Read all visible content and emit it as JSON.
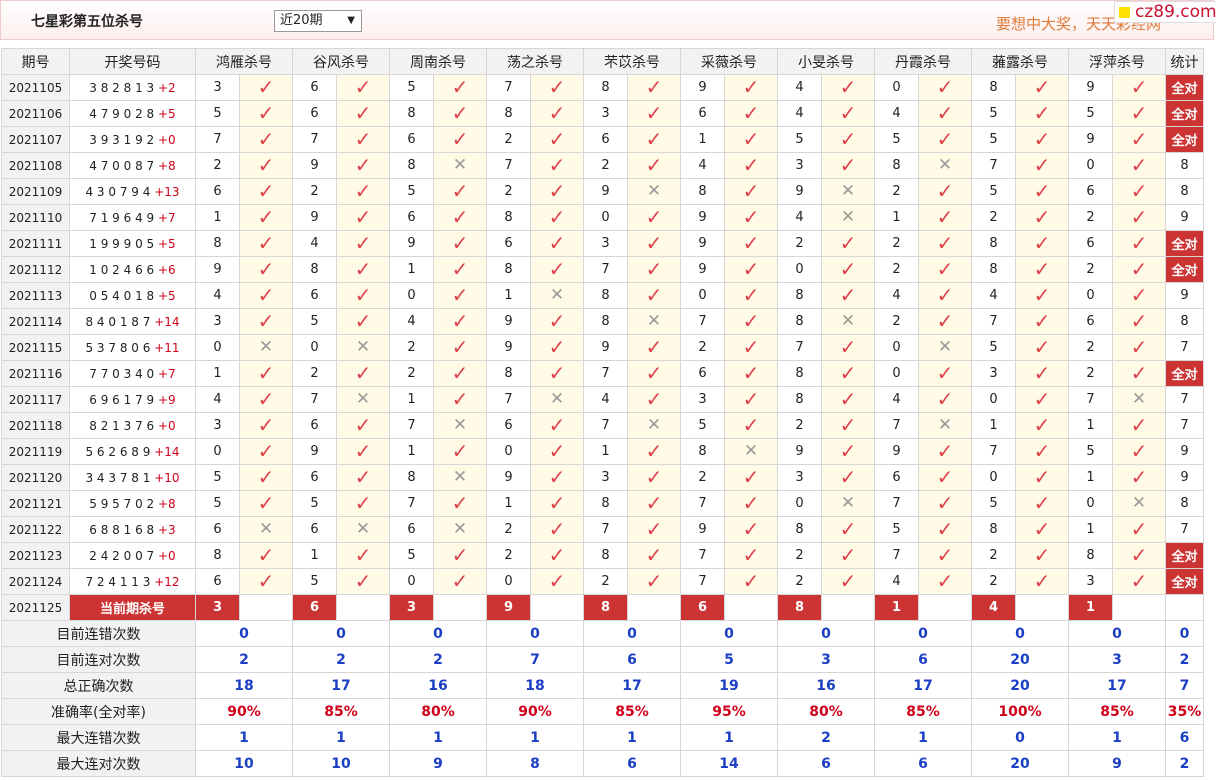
{
  "header": {
    "title": "七星彩第五位杀号",
    "period_select": "近20期",
    "slogan": "要想中大奖，天天彩经网",
    "logo": "cz89.com"
  },
  "columns": {
    "issue": "期号",
    "draw": "开奖号码",
    "experts": [
      "鸿雁杀号",
      "谷风杀号",
      "周南杀号",
      "荡之杀号",
      "芣苡杀号",
      "采薇杀号",
      "小旻杀号",
      "丹霞杀号",
      "蕥露杀号",
      "浮萍杀号"
    ],
    "stat": "统计"
  },
  "rows": [
    {
      "issue": "2021105",
      "draw": "3 8 2 8 1 3",
      "plus": "+2",
      "kills": [
        3,
        6,
        5,
        7,
        8,
        9,
        4,
        0,
        8,
        9
      ],
      "hits": [
        1,
        1,
        1,
        1,
        1,
        1,
        1,
        1,
        1,
        1
      ],
      "stat": "全对"
    },
    {
      "issue": "2021106",
      "draw": "4 7 9 0 2 8",
      "plus": "+5",
      "kills": [
        5,
        6,
        8,
        8,
        3,
        6,
        4,
        4,
        5,
        5
      ],
      "hits": [
        1,
        1,
        1,
        1,
        1,
        1,
        1,
        1,
        1,
        1
      ],
      "stat": "全对"
    },
    {
      "issue": "2021107",
      "draw": "3 9 3 1 9 2",
      "plus": "+0",
      "kills": [
        7,
        7,
        6,
        2,
        6,
        1,
        5,
        5,
        5,
        9
      ],
      "hits": [
        1,
        1,
        1,
        1,
        1,
        1,
        1,
        1,
        1,
        1
      ],
      "stat": "全对"
    },
    {
      "issue": "2021108",
      "draw": "4 7 0 0 8 7",
      "plus": "+8",
      "kills": [
        2,
        9,
        8,
        7,
        2,
        4,
        3,
        8,
        7,
        0
      ],
      "hits": [
        1,
        1,
        0,
        1,
        1,
        1,
        1,
        0,
        1,
        1
      ],
      "stat": "8"
    },
    {
      "issue": "2021109",
      "draw": "4 3 0 7 9 4",
      "plus": "+13",
      "kills": [
        6,
        2,
        5,
        2,
        9,
        8,
        9,
        2,
        5,
        6
      ],
      "hits": [
        1,
        1,
        1,
        1,
        0,
        1,
        0,
        1,
        1,
        1
      ],
      "stat": "8"
    },
    {
      "issue": "2021110",
      "draw": "7 1 9 6 4 9",
      "plus": "+7",
      "kills": [
        1,
        9,
        6,
        8,
        0,
        9,
        4,
        1,
        2,
        2
      ],
      "hits": [
        1,
        1,
        1,
        1,
        1,
        1,
        0,
        1,
        1,
        1
      ],
      "stat": "9"
    },
    {
      "issue": "2021111",
      "draw": "1 9 9 9 0 5",
      "plus": "+5",
      "kills": [
        8,
        4,
        9,
        6,
        3,
        9,
        2,
        2,
        8,
        6
      ],
      "hits": [
        1,
        1,
        1,
        1,
        1,
        1,
        1,
        1,
        1,
        1
      ],
      "stat": "全对"
    },
    {
      "issue": "2021112",
      "draw": "1 0 2 4 6 6",
      "plus": "+6",
      "kills": [
        9,
        8,
        1,
        8,
        7,
        9,
        0,
        2,
        8,
        2
      ],
      "hits": [
        1,
        1,
        1,
        1,
        1,
        1,
        1,
        1,
        1,
        1
      ],
      "stat": "全对"
    },
    {
      "issue": "2021113",
      "draw": "0 5 4 0 1 8",
      "plus": "+5",
      "kills": [
        4,
        6,
        0,
        1,
        8,
        0,
        8,
        4,
        4,
        0
      ],
      "hits": [
        1,
        1,
        1,
        0,
        1,
        1,
        1,
        1,
        1,
        1
      ],
      "stat": "9"
    },
    {
      "issue": "2021114",
      "draw": "8 4 0 1 8 7",
      "plus": "+14",
      "kills": [
        3,
        5,
        4,
        9,
        8,
        7,
        8,
        2,
        7,
        6
      ],
      "hits": [
        1,
        1,
        1,
        1,
        0,
        1,
        0,
        1,
        1,
        1
      ],
      "stat": "8"
    },
    {
      "issue": "2021115",
      "draw": "5 3 7 8 0 6",
      "plus": "+11",
      "kills": [
        0,
        0,
        2,
        9,
        9,
        2,
        7,
        0,
        5,
        2
      ],
      "hits": [
        0,
        0,
        1,
        1,
        1,
        1,
        1,
        0,
        1,
        1
      ],
      "stat": "7"
    },
    {
      "issue": "2021116",
      "draw": "7 7 0 3 4 0",
      "plus": "+7",
      "kills": [
        1,
        2,
        2,
        8,
        7,
        6,
        8,
        0,
        3,
        2
      ],
      "hits": [
        1,
        1,
        1,
        1,
        1,
        1,
        1,
        1,
        1,
        1
      ],
      "stat": "全对"
    },
    {
      "issue": "2021117",
      "draw": "6 9 6 1 7 9",
      "plus": "+9",
      "kills": [
        4,
        7,
        1,
        7,
        4,
        3,
        8,
        4,
        0,
        7
      ],
      "hits": [
        1,
        0,
        1,
        0,
        1,
        1,
        1,
        1,
        1,
        0
      ],
      "stat": "7"
    },
    {
      "issue": "2021118",
      "draw": "8 2 1 3 7 6",
      "plus": "+0",
      "kills": [
        3,
        6,
        7,
        6,
        7,
        5,
        2,
        7,
        1,
        1
      ],
      "hits": [
        1,
        1,
        0,
        1,
        0,
        1,
        1,
        0,
        1,
        1
      ],
      "stat": "7"
    },
    {
      "issue": "2021119",
      "draw": "5 6 2 6 8 9",
      "plus": "+14",
      "kills": [
        0,
        9,
        1,
        0,
        1,
        8,
        9,
        9,
        7,
        5
      ],
      "hits": [
        1,
        1,
        1,
        1,
        1,
        0,
        1,
        1,
        1,
        1
      ],
      "stat": "9"
    },
    {
      "issue": "2021120",
      "draw": "3 4 3 7 8 1",
      "plus": "+10",
      "kills": [
        5,
        6,
        8,
        9,
        3,
        2,
        3,
        6,
        0,
        1
      ],
      "hits": [
        1,
        1,
        0,
        1,
        1,
        1,
        1,
        1,
        1,
        1
      ],
      "stat": "9"
    },
    {
      "issue": "2021121",
      "draw": "5 9 5 7 0 2",
      "plus": "+8",
      "kills": [
        5,
        5,
        7,
        1,
        8,
        7,
        0,
        7,
        5,
        0
      ],
      "hits": [
        1,
        1,
        1,
        1,
        1,
        1,
        0,
        1,
        1,
        0
      ],
      "stat": "8"
    },
    {
      "issue": "2021122",
      "draw": "6 8 8 1 6 8",
      "plus": "+3",
      "kills": [
        6,
        6,
        6,
        2,
        7,
        9,
        8,
        5,
        8,
        1
      ],
      "hits": [
        0,
        0,
        0,
        1,
        1,
        1,
        1,
        1,
        1,
        1
      ],
      "stat": "7"
    },
    {
      "issue": "2021123",
      "draw": "2 4 2 0 0 7",
      "plus": "+0",
      "kills": [
        8,
        1,
        5,
        2,
        8,
        7,
        2,
        7,
        2,
        8
      ],
      "hits": [
        1,
        1,
        1,
        1,
        1,
        1,
        1,
        1,
        1,
        1
      ],
      "stat": "全对"
    },
    {
      "issue": "2021124",
      "draw": "7 2 4 1 1 3",
      "plus": "+12",
      "kills": [
        6,
        5,
        0,
        0,
        2,
        7,
        2,
        4,
        2,
        3
      ],
      "hits": [
        1,
        1,
        1,
        1,
        1,
        1,
        1,
        1,
        1,
        1
      ],
      "stat": "全对"
    }
  ],
  "current": {
    "issue": "2021125",
    "label": "当前期杀号",
    "kills": [
      3,
      6,
      3,
      9,
      8,
      6,
      8,
      1,
      4,
      1
    ]
  },
  "stats": [
    {
      "label": "目前连错次数",
      "values": [
        "0",
        "0",
        "0",
        "0",
        "0",
        "0",
        "0",
        "0",
        "0",
        "0"
      ],
      "total": "0",
      "style": "blue"
    },
    {
      "label": "目前连对次数",
      "values": [
        "2",
        "2",
        "2",
        "7",
        "6",
        "5",
        "3",
        "6",
        "20",
        "3"
      ],
      "total": "2",
      "style": "blue"
    },
    {
      "label": "总正确次数",
      "values": [
        "18",
        "17",
        "16",
        "18",
        "17",
        "19",
        "16",
        "17",
        "20",
        "17"
      ],
      "total": "7",
      "style": "blue"
    },
    {
      "label": "准确率(全对率)",
      "values": [
        "90%",
        "85%",
        "80%",
        "90%",
        "85%",
        "95%",
        "80%",
        "85%",
        "100%",
        "85%"
      ],
      "total": "35%",
      "style": "red"
    },
    {
      "label": "最大连错次数",
      "values": [
        "1",
        "1",
        "1",
        "1",
        "1",
        "1",
        "2",
        "1",
        "0",
        "1"
      ],
      "total": "6",
      "style": "blue"
    },
    {
      "label": "最大连对次数",
      "values": [
        "10",
        "10",
        "9",
        "8",
        "6",
        "14",
        "6",
        "6",
        "20",
        "9"
      ],
      "total": "2",
      "style": "blue"
    }
  ],
  "icons": {
    "hit": "check-icon",
    "miss": "cross-icon"
  },
  "colors": {
    "accent": "#cc3333",
    "hit": "#e0424b",
    "miss": "#9a9a9a",
    "blue": "#1b3fc4"
  }
}
